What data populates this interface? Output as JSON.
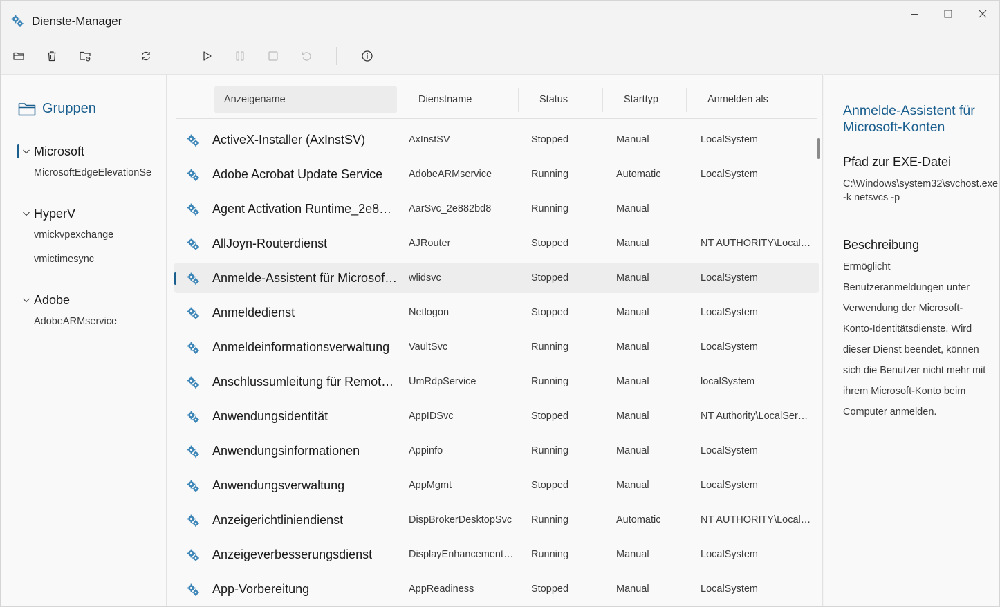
{
  "app": {
    "title": "Dienste-Manager"
  },
  "window_controls": [
    "minimize",
    "maximize",
    "close"
  ],
  "toolbar": {
    "buttons": [
      {
        "name": "open-folder-icon"
      },
      {
        "name": "delete-icon"
      },
      {
        "name": "folder-settings-icon"
      },
      {
        "name": "refresh-icon"
      },
      {
        "name": "start-icon"
      },
      {
        "name": "pause-icon",
        "disabled": true
      },
      {
        "name": "stop-icon",
        "disabled": true
      },
      {
        "name": "restart-icon",
        "disabled": true
      },
      {
        "name": "info-icon"
      }
    ]
  },
  "sidebar": {
    "title": "Gruppen",
    "groups": [
      {
        "name": "Microsoft",
        "selected": true,
        "children": [
          "MicrosoftEdgeElevationService"
        ]
      },
      {
        "name": "HyperV",
        "children": [
          "vmickvpexchange",
          "vmictimesync"
        ]
      },
      {
        "name": "Adobe",
        "children": [
          "AdobeARMservice"
        ]
      }
    ]
  },
  "table": {
    "columns": [
      "Anzeigename",
      "Dienstname",
      "Status",
      "Starttyp",
      "Anmelden als"
    ],
    "rows": [
      {
        "name": "ActiveX-Installer (AxInstSV)",
        "service": "AxInstSV",
        "status": "Stopped",
        "start": "Manual",
        "logon": "LocalSystem"
      },
      {
        "name": "Adobe Acrobat Update Service",
        "service": "AdobeARMservice",
        "status": "Running",
        "start": "Automatic",
        "logon": "LocalSystem"
      },
      {
        "name": "Agent Activation Runtime_2e882…",
        "service": "AarSvc_2e882bd8",
        "status": "Running",
        "start": "Manual",
        "logon": ""
      },
      {
        "name": "AllJoyn-Routerdienst",
        "service": "AJRouter",
        "status": "Stopped",
        "start": "Manual",
        "logon": "NT AUTHORITY\\LocalS…"
      },
      {
        "name": "Anmelde-Assistent für Microsoft…",
        "service": "wlidsvc",
        "status": "Stopped",
        "start": "Manual",
        "logon": "LocalSystem",
        "selected": true
      },
      {
        "name": "Anmeldedienst",
        "service": "Netlogon",
        "status": "Stopped",
        "start": "Manual",
        "logon": "LocalSystem"
      },
      {
        "name": "Anmeldeinformationsverwaltung",
        "service": "VaultSvc",
        "status": "Running",
        "start": "Manual",
        "logon": "LocalSystem"
      },
      {
        "name": "Anschlussumleitung für Remoted…",
        "service": "UmRdpService",
        "status": "Running",
        "start": "Manual",
        "logon": "localSystem"
      },
      {
        "name": "Anwendungsidentität",
        "service": "AppIDSvc",
        "status": "Stopped",
        "start": "Manual",
        "logon": "NT Authority\\LocalSer…"
      },
      {
        "name": "Anwendungsinformationen",
        "service": "Appinfo",
        "status": "Running",
        "start": "Manual",
        "logon": "LocalSystem"
      },
      {
        "name": "Anwendungsverwaltung",
        "service": "AppMgmt",
        "status": "Stopped",
        "start": "Manual",
        "logon": "LocalSystem"
      },
      {
        "name": "Anzeigerichtliniendienst",
        "service": "DispBrokerDesktopSvc",
        "status": "Running",
        "start": "Automatic",
        "logon": "NT AUTHORITY\\LocalS…"
      },
      {
        "name": "Anzeigeverbesserungsdienst",
        "service": "DisplayEnhancementS…",
        "status": "Running",
        "start": "Manual",
        "logon": "LocalSystem"
      },
      {
        "name": "App-Vorbereitung",
        "service": "AppReadiness",
        "status": "Stopped",
        "start": "Manual",
        "logon": "LocalSystem"
      }
    ]
  },
  "details": {
    "title": "Anmelde-Assistent für Microsoft-Konten",
    "path_heading": "Pfad zur EXE-Datei",
    "path": "C:\\Windows\\system32\\svchost.exe -k netsvcs -p",
    "desc_heading": "Beschreibung",
    "description": "Ermöglicht Benutzeranmeldungen unter Verwendung der Microsoft-Konto-Identitätsdienste. Wird dieser Dienst beendet, können sich die Benutzer nicht mehr mit ihrem Microsoft-Konto beim Computer anmelden."
  },
  "colors": {
    "accent": "#1b5f8f",
    "gear": "#3d86b8"
  }
}
